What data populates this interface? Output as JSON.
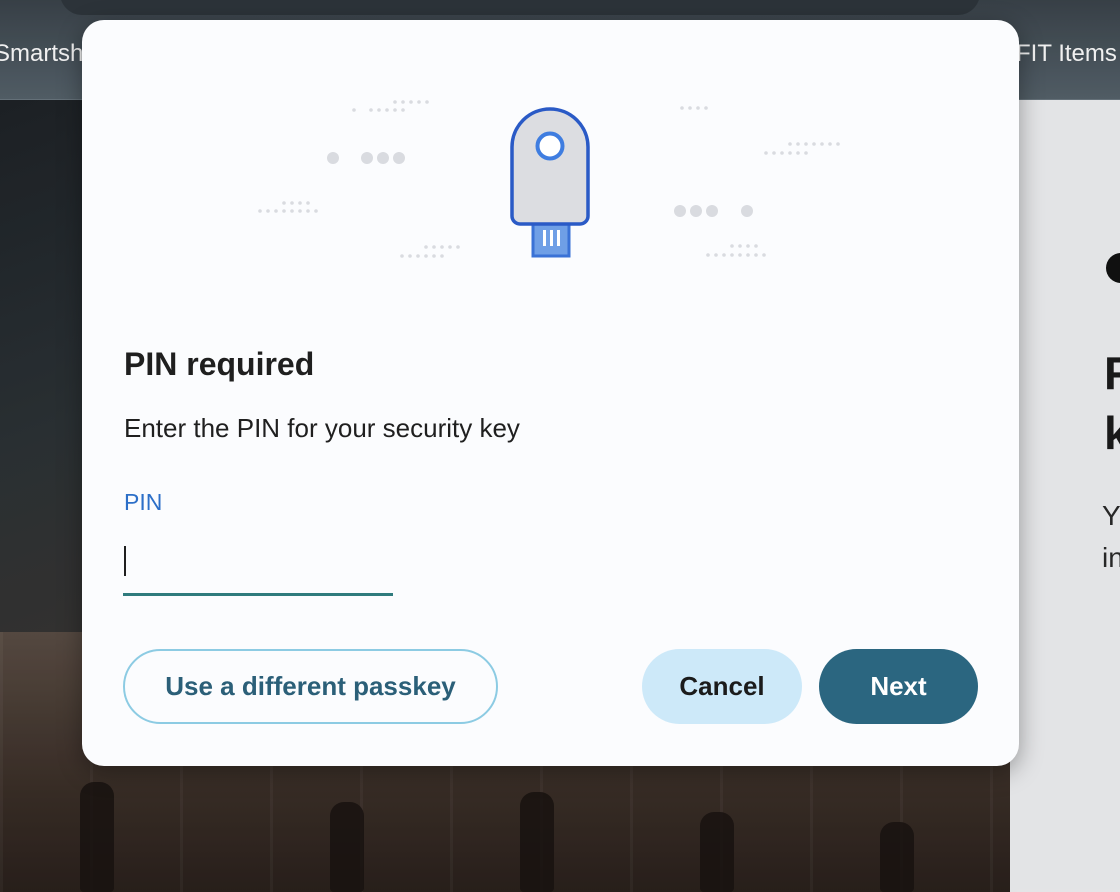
{
  "bookmarks": {
    "left_label": "Smartsh",
    "right_label": "FIT Items"
  },
  "side_panel": {
    "heading_line1": "F",
    "heading_line2": "k",
    "body_line1": "Y",
    "body_line2": "in"
  },
  "dialog": {
    "title": "PIN required",
    "description": "Enter the PIN for your security key",
    "pin_label": "PIN",
    "pin_value": "",
    "buttons": {
      "different_passkey": "Use a different passkey",
      "cancel": "Cancel",
      "next": "Next"
    }
  },
  "colors": {
    "accent_blue": "#2c6fc8",
    "input_underline": "#2f7b7d",
    "primary_button": "#2b6680",
    "secondary_button": "#cde9f9",
    "outline_button_border": "#8ccbe3"
  },
  "icons": {
    "illustration": "security-key-icon"
  }
}
